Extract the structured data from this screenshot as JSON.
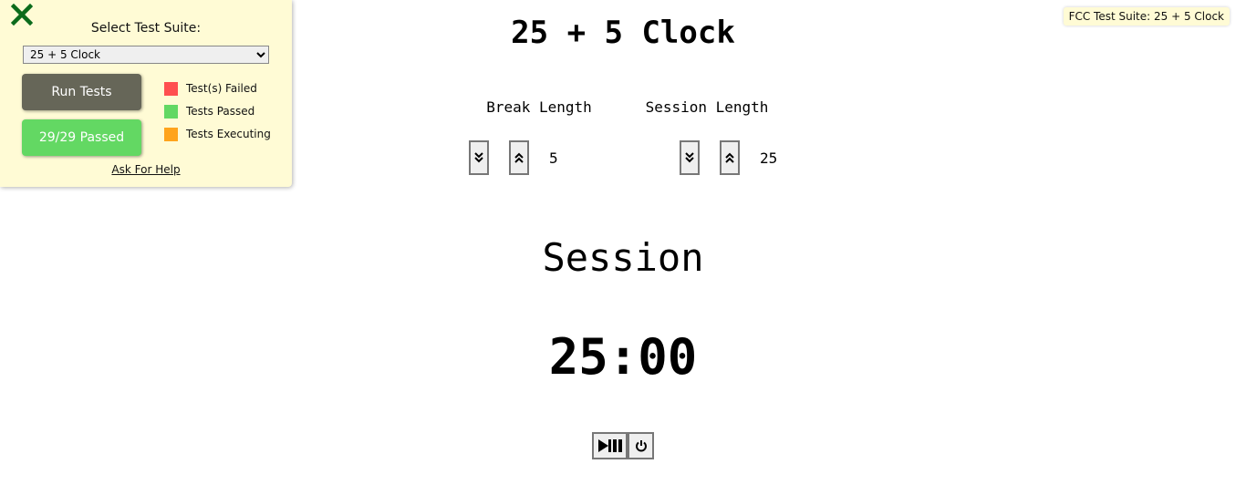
{
  "fcc": {
    "title": "Select Test Suite:",
    "selected_suite": "25 + 5 Clock",
    "run_button": "Run Tests",
    "result_button": "29/29 Passed",
    "legend": [
      {
        "label": "Test(s) Failed",
        "color": "#ff4f4f"
      },
      {
        "label": "Tests Passed",
        "color": "#63d863"
      },
      {
        "label": "Tests Executing",
        "color": "#ffa41c"
      }
    ],
    "help_link": "Ask For Help",
    "tooltip": "FCC Test Suite: 25 + 5 Clock",
    "close_icon": "×"
  },
  "clock": {
    "title": "25 + 5 Clock",
    "break": {
      "label": "Break Length",
      "value": "5"
    },
    "session": {
      "label": "Session Length",
      "value": "25"
    },
    "timer_label": "Session",
    "time_left": "25:00"
  }
}
